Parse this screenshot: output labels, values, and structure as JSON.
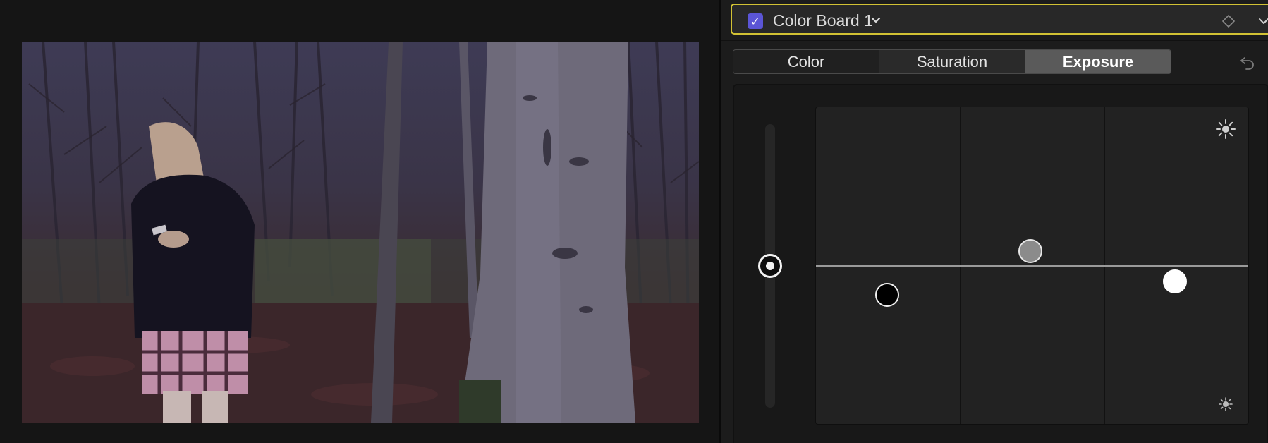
{
  "effect": {
    "name": "Color Board 1",
    "enabled": true,
    "checkbox_color": "#5b55d6",
    "highlight_border": "#d2c234"
  },
  "tabs": [
    {
      "label": "Color",
      "active": false
    },
    {
      "label": "Saturation",
      "active": false
    },
    {
      "label": "Exposure",
      "active": true
    }
  ],
  "icons": {
    "checkbox": "checkmark-icon",
    "menu": "chevron-down-icon",
    "keyframe": "diamond-icon",
    "disclosure": "chevron-down-icon",
    "reset": "reset-arrow-icon",
    "brighter": "sun-large-icon",
    "darker": "sun-small-icon"
  },
  "board": {
    "pucks": [
      {
        "name": "shadows",
        "color": "#000000"
      },
      {
        "name": "midtones",
        "color": "#8b8b8b"
      },
      {
        "name": "highlights",
        "color": "#ffffff"
      }
    ]
  }
}
